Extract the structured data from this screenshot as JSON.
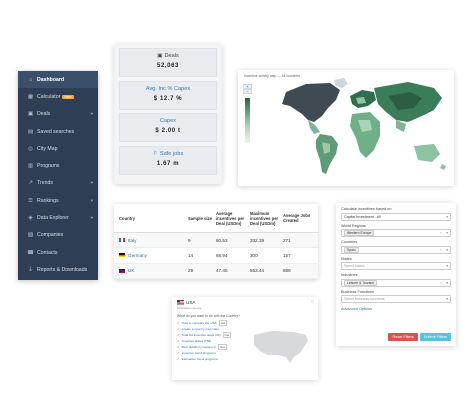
{
  "sidebar": {
    "items": [
      {
        "label": "Dashboard",
        "icon": "dashboard-icon",
        "glyph": "⌂",
        "active": true,
        "badge": "",
        "chevron": false
      },
      {
        "label": "Calculator",
        "icon": "calculator-icon",
        "glyph": "▦",
        "active": false,
        "badge": "New",
        "chevron": false
      },
      {
        "label": "Deals",
        "icon": "deals-icon",
        "glyph": "▣",
        "active": false,
        "badge": "",
        "chevron": true
      },
      {
        "label": "Saved searches",
        "icon": "bookmark-icon",
        "glyph": "▤",
        "active": false,
        "badge": "",
        "chevron": false
      },
      {
        "label": "City Map",
        "icon": "map-icon",
        "glyph": "◎",
        "active": false,
        "badge": "",
        "chevron": false
      },
      {
        "label": "Programs",
        "icon": "programs-icon",
        "glyph": "▥",
        "active": false,
        "badge": "",
        "chevron": false
      },
      {
        "label": "Trends",
        "icon": "trends-icon",
        "glyph": "↗",
        "active": false,
        "badge": "",
        "chevron": true
      },
      {
        "label": "Rankings",
        "icon": "rankings-icon",
        "glyph": "☰",
        "active": false,
        "badge": "",
        "chevron": true
      },
      {
        "label": "Data Explorer",
        "icon": "explorer-icon",
        "glyph": "◈",
        "active": false,
        "badge": "",
        "chevron": true
      },
      {
        "label": "Companies",
        "icon": "companies-icon",
        "glyph": "▧",
        "active": false,
        "badge": "",
        "chevron": false
      },
      {
        "label": "Contacts",
        "icon": "contacts-icon",
        "glyph": "☎",
        "active": false,
        "badge": "",
        "chevron": false
      },
      {
        "label": "Reports & Downloads",
        "icon": "reports-icon",
        "glyph": "⤓",
        "active": false,
        "badge": "",
        "chevron": false
      }
    ]
  },
  "stats": [
    {
      "label": "Deals",
      "value": "52,063",
      "icon": "briefcase-icon",
      "glyph": "▣"
    },
    {
      "label": "Avg. Inc % Capex",
      "value": "$ 12.7 %",
      "icon": "",
      "glyph": ""
    },
    {
      "label": "Capex",
      "value": "$ 2.00 t",
      "icon": "",
      "glyph": ""
    },
    {
      "label": "Safe jobs",
      "value": "1.67 m",
      "icon": "jobs-icon",
      "glyph": "⚐"
    }
  ],
  "map": {
    "title": "Incentive activity map — All countries"
  },
  "table": {
    "headers": [
      "Country",
      "Sample size",
      "Average incentives per Deal (USDm)",
      "Maximum incentives per Deal (USDm)",
      "Average Jobs Created"
    ],
    "rows": [
      {
        "country": "Italy",
        "flag": "italy-flag",
        "sample": "9",
        "avg": "80.53",
        "max": "332.39",
        "jobs": "271"
      },
      {
        "country": "Germany",
        "flag": "germany-flag",
        "sample": "14",
        "avg": "68.94",
        "max": "300",
        "jobs": "157"
      },
      {
        "country": "UK",
        "flag": "uk-flag",
        "sample": "29",
        "avg": "47.45",
        "max": "553.44",
        "jobs": "688"
      }
    ]
  },
  "filters": {
    "title": "Calculate incentives based on",
    "basis": "Capital Investment - All",
    "world_regions_label": "World Regions",
    "world_regions_value": "Western Europe",
    "countries_label": "Countries",
    "countries_value": "Spain",
    "states_label": "States",
    "states_placeholder": "Select states",
    "industries_label": "Industries",
    "industries_value": "Leisure & Tourism",
    "business_label": "Business Functions",
    "business_placeholder": "Select business functions",
    "advanced": "Advanced Options",
    "reset": "Reset Filters",
    "submit": "Submit Filters"
  },
  "usa": {
    "title": "USA",
    "subtitle": "Incentives country",
    "question": "What do you want to do with the Country?",
    "items": [
      {
        "text": "How to compare the USA",
        "tag": "Get"
      },
      {
        "text": "Create a country map state",
        "tag": ""
      },
      {
        "text": "Total list incentive deals (38)",
        "tag": "Get"
      },
      {
        "text": "Incentive states (158)",
        "tag": ""
      },
      {
        "text": "Best details by regions in",
        "tag": "Get"
      },
      {
        "text": "Incentive trend programs",
        "tag": ""
      },
      {
        "text": "Estimation trend programs",
        "tag": ""
      }
    ]
  }
}
